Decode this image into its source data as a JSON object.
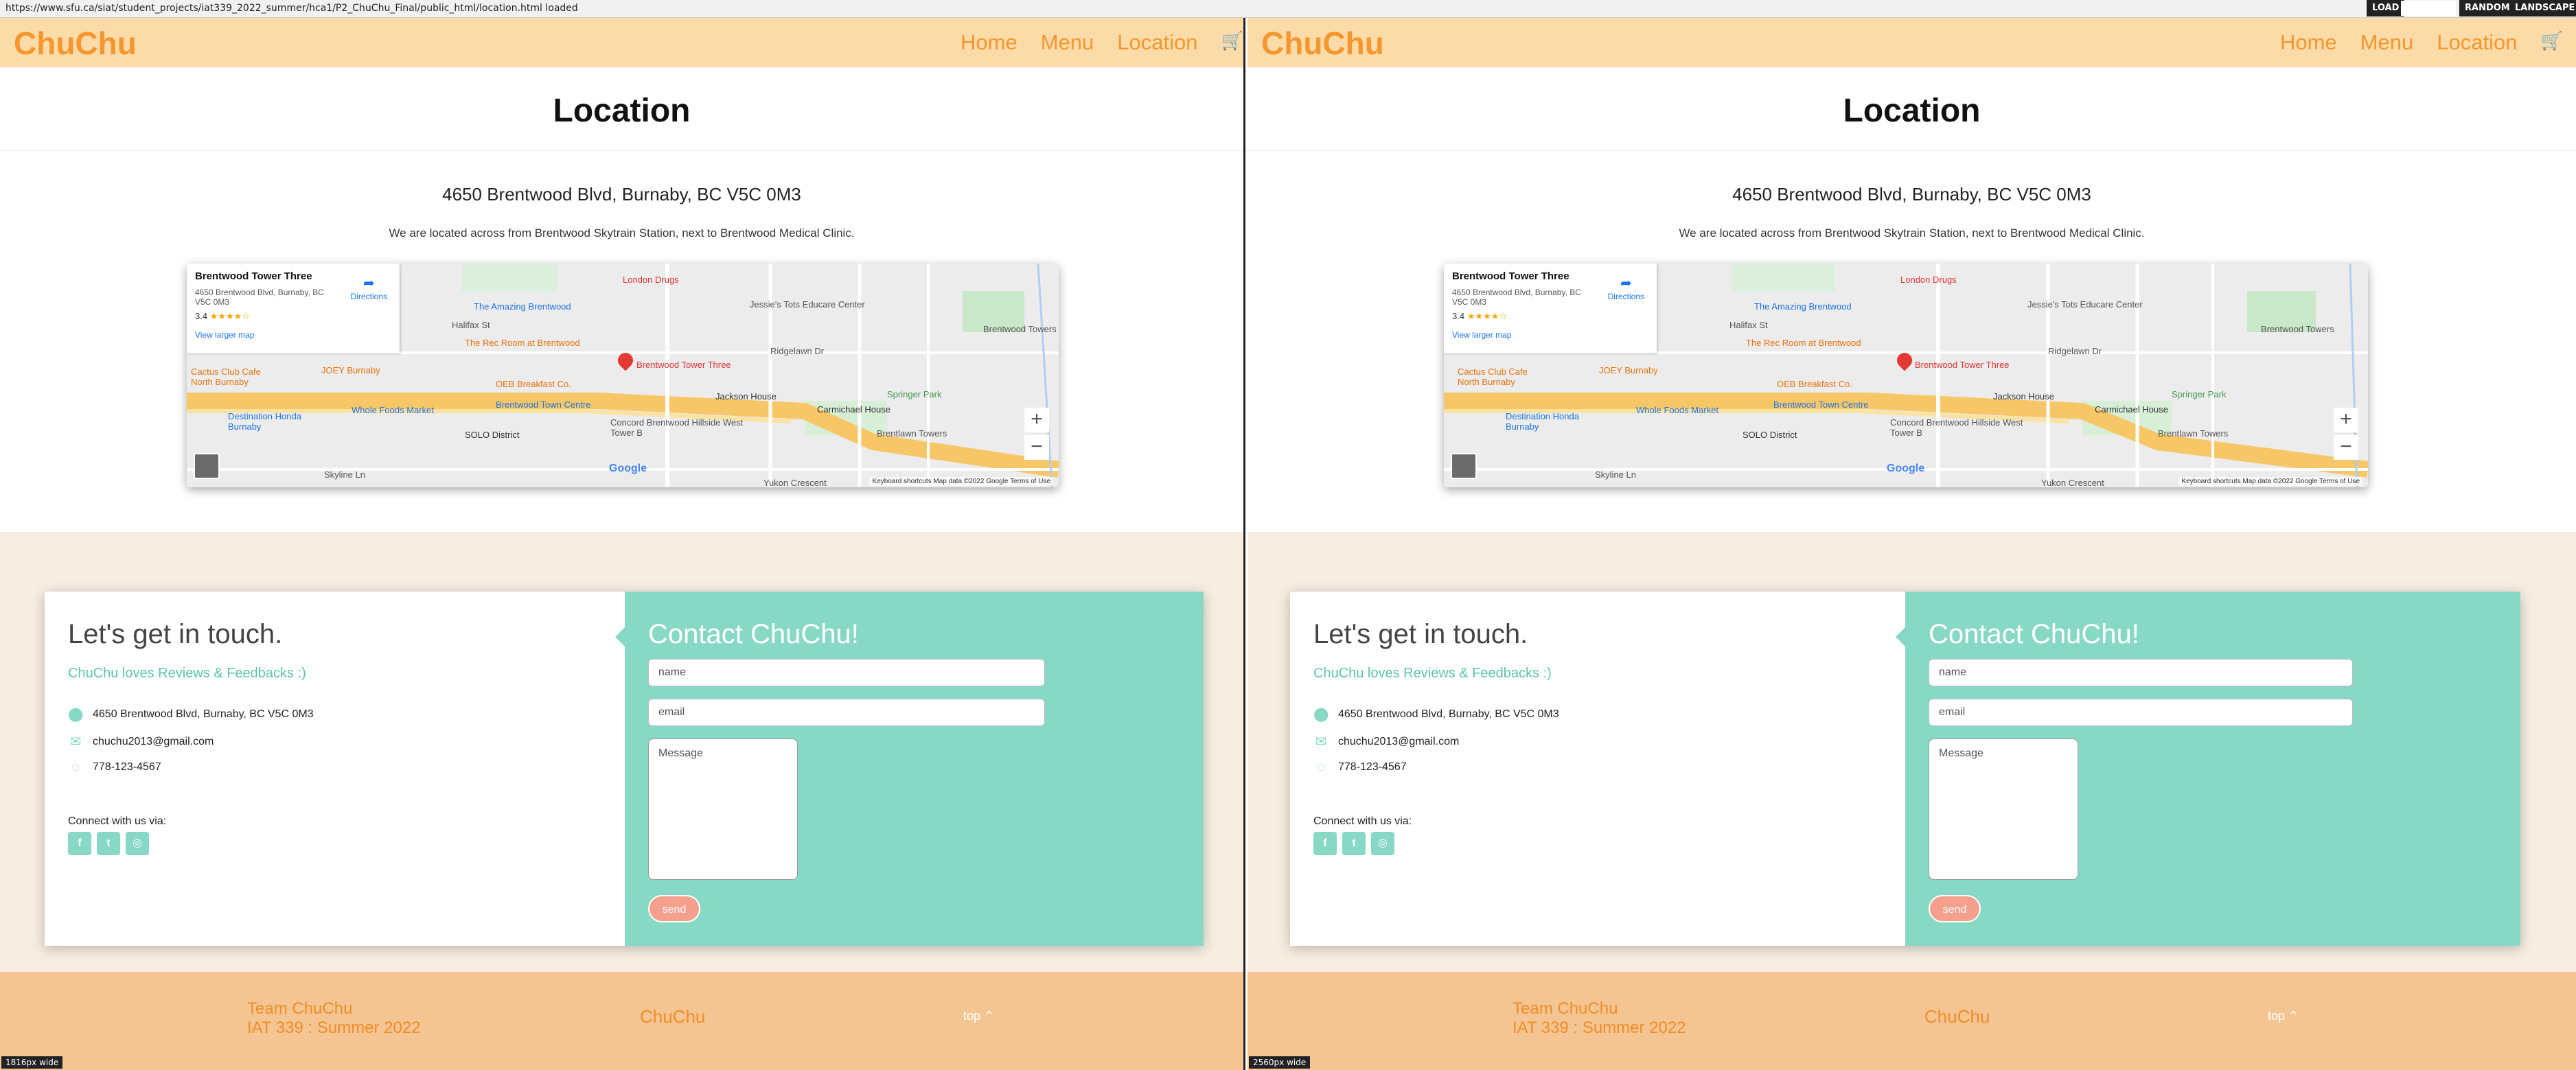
{
  "toolbar": {
    "url": "https://www.sfu.ca/siat/student_projects/iat339_2022_summer/hca1/P2_ChuChu_Final/public_html/location.html loaded",
    "load": "LOAD",
    "random": "RANDOM",
    "landscape": "LANDSCAPE"
  },
  "site": {
    "brand": "ChuChu",
    "nav": [
      "Home",
      "Menu",
      "Location"
    ],
    "cart_icon": "shopping-cart-icon",
    "page_title": "Location",
    "address": "4650 Brentwood Blvd, Burnaby, BC V5C 0M3",
    "located": "We are located across from Brentwood Skytrain Station, next to Brentwood Medical Clinic.",
    "map": {
      "place": "Brentwood Tower Three",
      "place_address": "4650 Brentwood Blvd, Burnaby, BC V5C 0M3",
      "rating": "3.4",
      "stars": "★★★★☆",
      "directions": "Directions",
      "view_larger": "View larger map",
      "zoom_in": "+",
      "zoom_out": "−",
      "google": "Google",
      "footer": "Keyboard shortcuts   Map data ©2022 Google   Terms of Use",
      "labels": [
        "The Amazing Brentwood",
        "London Drugs",
        "Jessie's Tots Educare Center",
        "Brentwood Towers",
        "JOEY Burnaby",
        "The Rec Room at Brentwood",
        "OEB Breakfast Co.",
        "Whole Foods Market",
        "Brentwood Town Centre",
        "Jackson House",
        "Carmichael House",
        "Springer Park",
        "Concord Brentwood Hillside West Tower B",
        "Brentlawn Towers",
        "SOLO District",
        "Destination Honda Burnaby",
        "Cactus Club Cafe North Burnaby",
        "Skyline Ln",
        "Yukon Crescent",
        "Ridgelawn Dr",
        "Halifax St"
      ]
    },
    "contact": {
      "touch_title": "Let's get in touch.",
      "touch_sub": "ChuChu loves Reviews & Feedbacks :)",
      "address": "4650 Brentwood Blvd, Burnaby, BC V5C 0M3",
      "email": "chuchu2013@gmail.com",
      "phone": "778-123-4567",
      "connect": "Connect with us via:",
      "socials": [
        "f",
        "t",
        "◎"
      ],
      "form_title": "Contact ChuChu!",
      "name_placeholder": "name",
      "email_placeholder": "email",
      "message_placeholder": "Message",
      "send": "send"
    },
    "footer": {
      "team_line1": "Team ChuChu",
      "team_line2": "IAT 339 : Summer 2022",
      "brand": "ChuChu",
      "top": "top ⌃"
    }
  },
  "left_pane": {
    "width_badge": "1816px wide"
  },
  "right_pane": {
    "width_badge": "2560px wide"
  },
  "colors": {
    "brand_orange": "#f5962e",
    "header_bg": "#fbdca9",
    "mint": "#88d8c6",
    "footer_bg": "#f4c592",
    "send": "#f5a08d"
  }
}
